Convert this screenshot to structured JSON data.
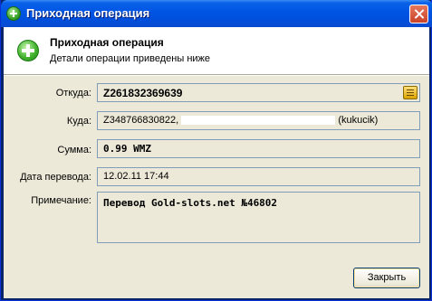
{
  "window": {
    "title": "Приходная операция"
  },
  "header": {
    "title": "Приходная операция",
    "subtitle": "Детали операции приведены ниже"
  },
  "fields": {
    "from_label": "Откуда:",
    "from_value": "Z261832369639",
    "to_label": "Куда:",
    "to_value_start": "Z348766830822,",
    "to_value_end": "(kukucik)",
    "amount_label": "Сумма:",
    "amount_value": "0.99 WMZ",
    "date_label": "Дата перевода:",
    "date_value": "12.02.11 17:44",
    "note_label": "Примечание:",
    "note_value": "Перевод Gold-slots.net №46802"
  },
  "buttons": {
    "close_label": "Закрыть"
  },
  "icons": {
    "title": "plus-icon",
    "header": "plus-icon",
    "address_book": "address-book-icon"
  },
  "colors": {
    "titlebar": "#0054e3",
    "panel": "#ece9d8",
    "field_border": "#7f9db9"
  }
}
